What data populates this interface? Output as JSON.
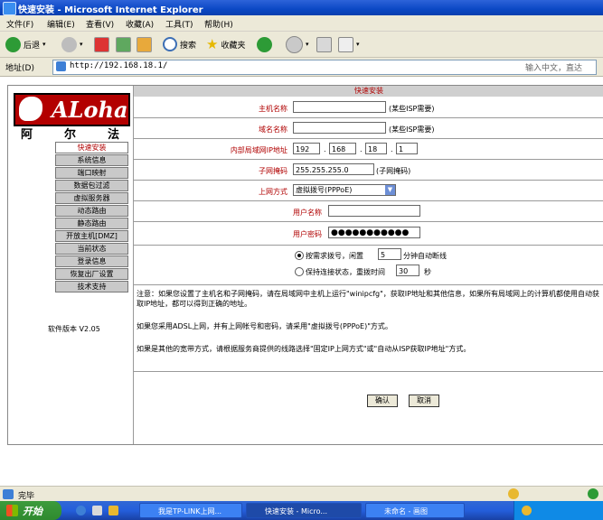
{
  "window": {
    "title": "快速安装 - Microsoft Internet Explorer"
  },
  "menu": [
    "文件(F)",
    "编辑(E)",
    "查看(V)",
    "收藏(A)",
    "工具(T)",
    "帮助(H)"
  ],
  "toolbar": {
    "back": "后退",
    "search": "搜索",
    "favorites": "收藏夹"
  },
  "address": {
    "label": "地址(D)",
    "url": "http://192.168.18.1/",
    "right_hint": "输入中文，直达"
  },
  "brand": {
    "logo_text": "ALoha",
    "cn": [
      "阿",
      "尔",
      "法"
    ]
  },
  "nav": [
    "快速安装",
    "系统信息",
    "端口映射",
    "数据包过滤",
    "虚拟服务器",
    "动态路由",
    "静态路由",
    "开放主机[DMZ]",
    "当前状态",
    "登录信息",
    "恢复出厂设置",
    "技术支持"
  ],
  "version": "软件版本 V2.05",
  "form": {
    "header": "快速安装",
    "host_label": "主机名称",
    "host_hint": "(某些ISP需要)",
    "domain_label": "域名名称",
    "domain_hint": "(某些ISP需要)",
    "lan_ip_label": "内部局域网IP地址",
    "ip": [
      "192",
      "168",
      "18",
      "1"
    ],
    "mask_label": "子网掩码",
    "mask_value": "255.255.255.0",
    "mask_hint": "(子网掩码)",
    "conn_label": "上网方式",
    "conn_value": "虚拟拨号(PPPoE)",
    "user_label": "用户名称",
    "pass_label": "用户密码",
    "pass_value": "●●●●●●●●●●●",
    "opt1_text": "按需求拨号，闲置",
    "opt1_after": "分钟自动断线",
    "idle_value": "5",
    "opt2_text": "保持连接状态，重拨时间",
    "opt2_value": "30",
    "opt2_after": "秒"
  },
  "notes": [
    "注意：如果您设置了主机名和子网掩码，请在局域网中主机上运行\"winipcfg\"，获取IP地址和其他信息，如果所有局域网上的计算机都使用自动获取IP地址，都可以得到正确的地址。",
    "如果您采用ADSL上网，并有上网帐号和密码，请采用\"虚拟拨号(PPPoE)\"方式。",
    "如果是其他的宽带方式，请根据服务商提供的线路选择\"固定IP上网方式\"或\"自动从ISP获取IP地址\"方式。"
  ],
  "buttons": {
    "ok": "确认",
    "cancel": "取消"
  },
  "status": {
    "text": "完毕"
  },
  "taskbar": {
    "start": "开始",
    "tasks": [
      "我是TP-LINK上网...",
      "快速安装 - Micro...",
      "未命名 - 画图"
    ],
    "active_index": 1
  }
}
